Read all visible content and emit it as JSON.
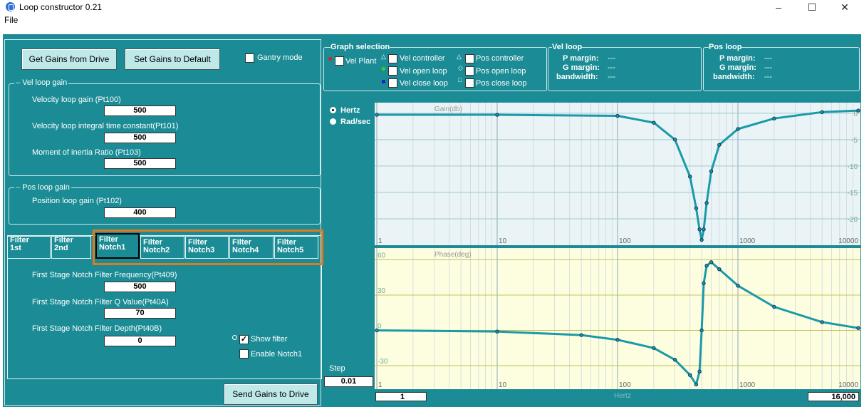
{
  "window": {
    "title": "Loop constructor 0.21",
    "min": "–",
    "max": "☐",
    "close": "✕"
  },
  "menu": {
    "file": "File"
  },
  "top": {
    "get_gains": "Get Gains from Drive",
    "set_default": "Set Gains to Default",
    "gantry": "Gantry mode"
  },
  "vel_loop_gain": {
    "legend": "Vel loop gain",
    "items": [
      {
        "label": "Velocity loop gain (Pt100)",
        "value": "500"
      },
      {
        "label": "Velocity loop integral time constant(Pt101)",
        "value": "500"
      },
      {
        "label": "Moment of inertia Ratio (Pt103)",
        "value": "500"
      }
    ]
  },
  "pos_loop_gain": {
    "legend": "Pos loop gain",
    "label": "Position loop gain (Pt102)",
    "value": "400"
  },
  "tabs": [
    {
      "l1": "Filter",
      "l2": "1st"
    },
    {
      "l1": "Filter",
      "l2": "2nd"
    },
    {
      "l1": "Filter",
      "l2": "Notch1"
    },
    {
      "l1": "Filter",
      "l2": "Notch2"
    },
    {
      "l1": "Filter",
      "l2": "Notch3"
    },
    {
      "l1": "Filter",
      "l2": "Notch4"
    },
    {
      "l1": "Filter",
      "l2": "Notch5"
    }
  ],
  "notch": {
    "freq_label": "First Stage Notch Filter Frequency(Pt409)",
    "freq": "500",
    "q_label": "First Stage Notch Filter Q Value(Pt40A)",
    "q": "70",
    "depth_label": "First Stage Notch Filter Depth(Pt40B)",
    "depth": "0",
    "show_filter": "Show filter",
    "enable": "Enable Notch1"
  },
  "send": "Send Gains to Drive",
  "graph_sel": {
    "legend": "Graph selection",
    "vel_plant": "Vel Plant",
    "vel_controller": "Vel controller",
    "pos_controller": "Pos controller",
    "vel_open": "Vel open loop",
    "pos_open": "Pos open loop",
    "vel_close": "Vel close loop",
    "pos_close": "Pos close loop"
  },
  "vel_loop": {
    "legend": "Vel loop",
    "p": "P margin:",
    "g": "G margin:",
    "bw": "bandwidth:",
    "p_val": "---",
    "g_val": "---",
    "bw_val": "---"
  },
  "pos_loop": {
    "legend": "Pos loop",
    "p": "P margin:",
    "g": "G margin:",
    "bw": "bandwidth:",
    "p_val": "---",
    "g_val": "---",
    "bw_val": "---"
  },
  "units": {
    "hertz": "Hertz",
    "rad": "Rad/sec"
  },
  "step": {
    "label": "Step",
    "value": "0.01"
  },
  "range": {
    "min": "1",
    "max": "16,000",
    "axis": "Hertz"
  },
  "colors": {
    "bg": "#1b8c95",
    "curve": "#1a9aa8",
    "highlight": "#e07a20"
  },
  "chart_data": [
    {
      "type": "line",
      "title": "Gain(db)",
      "x_scale": "log",
      "xlim": [
        1,
        10000
      ],
      "ylim": [
        -25,
        2
      ],
      "x_ticks": [
        "1",
        "10",
        "100",
        "1000",
        "10000"
      ],
      "y_ticks": [
        "0",
        "-5",
        "-10",
        "-15",
        "-20"
      ],
      "series": [
        {
          "x": [
            1,
            10,
            100,
            200,
            300,
            400,
            450,
            480,
            500,
            520,
            550,
            600,
            700,
            1000,
            2000,
            5000,
            10000
          ],
          "y": [
            -0.3,
            -0.3,
            -0.5,
            -1.8,
            -5,
            -12,
            -18,
            -22,
            -24,
            -22,
            -17,
            -11,
            -6,
            -3,
            -1,
            0.2,
            0.5
          ]
        }
      ]
    },
    {
      "type": "line",
      "title": "Phase(deg)",
      "x_scale": "log",
      "xlim": [
        1,
        10000
      ],
      "ylim": [
        -50,
        70
      ],
      "x_ticks": [
        "1",
        "10",
        "100",
        "1000",
        "10000"
      ],
      "y_ticks": [
        "60",
        "30",
        "0",
        "-30"
      ],
      "series": [
        {
          "x": [
            1,
            10,
            50,
            100,
            200,
            300,
            400,
            450,
            480,
            500,
            520,
            550,
            600,
            700,
            1000,
            2000,
            5000,
            10000
          ],
          "y": [
            0,
            -1,
            -4,
            -8,
            -15,
            -25,
            -38,
            -46,
            -35,
            0,
            40,
            55,
            58,
            52,
            38,
            20,
            7,
            2
          ]
        }
      ]
    }
  ]
}
